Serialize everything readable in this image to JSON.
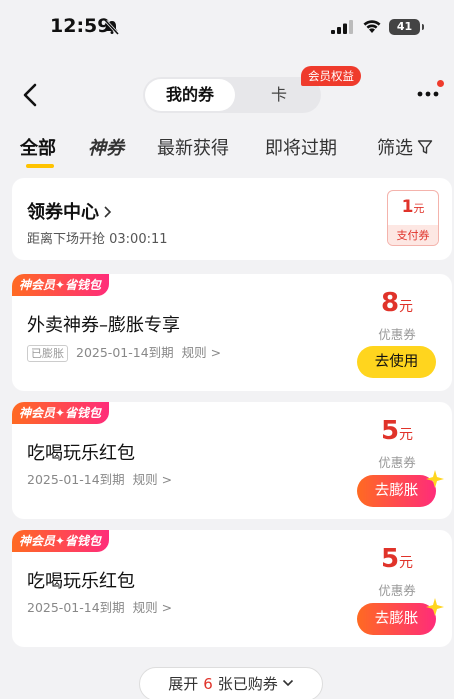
{
  "status_bar": {
    "time": "12:59",
    "battery": "41"
  },
  "nav": {
    "segments": [
      "我的券",
      "卡"
    ],
    "member_badge": "会员权益"
  },
  "tabs": [
    {
      "label": "全部"
    },
    {
      "label": "神券"
    },
    {
      "label": "最新获得"
    },
    {
      "label": "即将过期"
    },
    {
      "label": "筛选"
    }
  ],
  "coupon_center": {
    "title": "领券中心",
    "subtitle": "距离下场开抢 03:00:11",
    "badge_amount": "1",
    "badge_unit": "元",
    "badge_label": "支付券"
  },
  "coupons": [
    {
      "tag": "神会员✦省钱包",
      "title": "外卖神券–膨胀专享",
      "status_tag": "已膨胀",
      "expiry": "2025-01-14到期",
      "rules": "规则 >",
      "amount": "8",
      "unit": "元",
      "label": "优惠券",
      "button": "去使用"
    },
    {
      "tag": "神会员✦省钱包",
      "title": "吃喝玩乐红包",
      "expiry": "2025-01-14到期",
      "rules": "规则 >",
      "amount": "5",
      "unit": "元",
      "label": "优惠券",
      "button": "去膨胀"
    },
    {
      "tag": "神会员✦省钱包",
      "title": "吃喝玩乐红包",
      "expiry": "2025-01-14到期",
      "rules": "规则 >",
      "amount": "5",
      "unit": "元",
      "label": "优惠券",
      "button": "去膨胀"
    }
  ],
  "expand": {
    "prefix": "展开",
    "count": "6",
    "suffix": "张已购券"
  },
  "colors": {
    "accent_red": "#e0332a",
    "yellow": "#ffd51e",
    "gradient_start": "#ff6a22",
    "gradient_end": "#ff2c7a"
  }
}
